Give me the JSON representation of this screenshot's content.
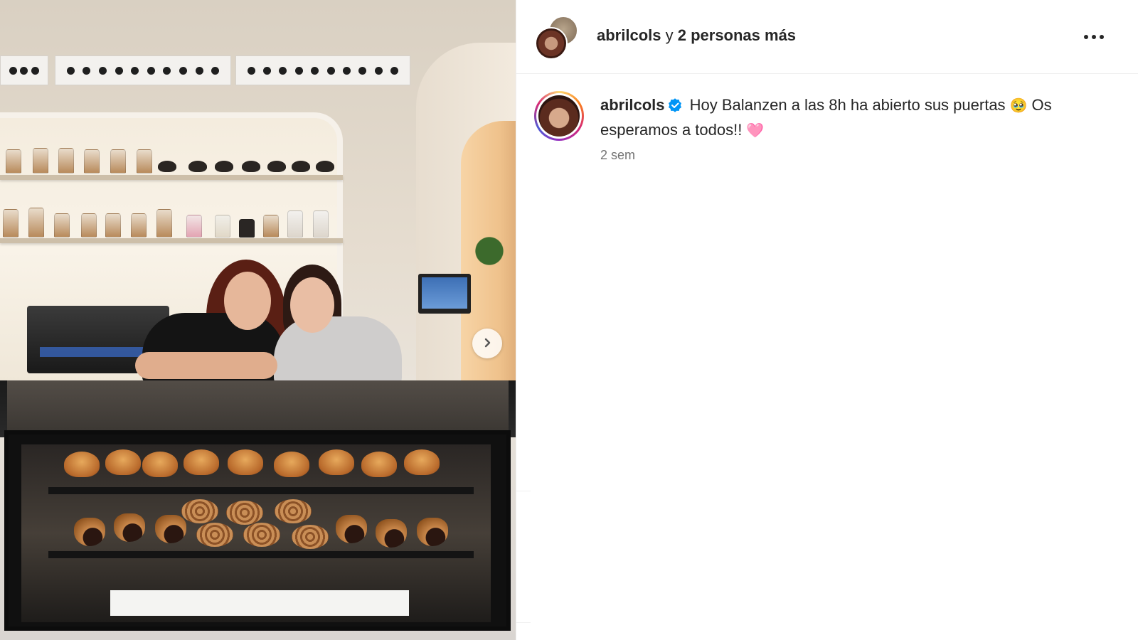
{
  "header": {
    "username": "abrilcols",
    "connector": "y",
    "others": "2 personas más"
  },
  "caption": {
    "username": "abrilcols",
    "text_1": "Hoy Balanzen a las 8h ha abierto sus puertas",
    "emoji_1": "🥹",
    "text_2": "Os esperamos a todos!!",
    "emoji_2": "🩷",
    "timestamp": "2 sem"
  },
  "photo": {
    "icons": {
      "next": "chevron-right-icon",
      "more": "more-horizontal-icon",
      "verified": "verified-badge-icon"
    }
  },
  "colors": {
    "text": "#262626",
    "muted": "#737373",
    "verified": "#0095f6",
    "divider": "#efefef"
  }
}
